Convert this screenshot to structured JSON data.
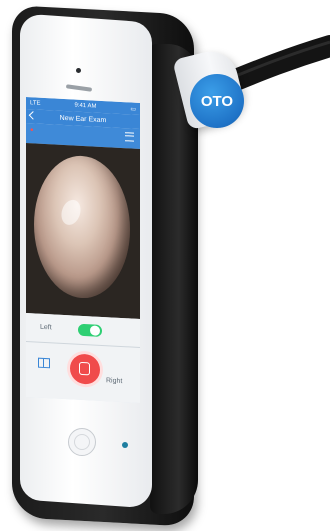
{
  "brand": {
    "badge_text": "OTO",
    "badge_color": "#2b8ee0"
  },
  "status_bar": {
    "carrier": "LTE",
    "time": "9:41 AM"
  },
  "screen": {
    "title": "New Ear Exam",
    "left_label": "Left",
    "right_label": "Right",
    "toggle_on": true
  },
  "colors": {
    "accent": "#3a86d6",
    "capture": "#f04b4b",
    "toggle": "#2ecf73",
    "case": "#1b1b1b"
  },
  "icons": [
    "back-chevron-icon",
    "menu-icon",
    "split-view-icon",
    "capture-icon",
    "home-button-icon"
  ]
}
